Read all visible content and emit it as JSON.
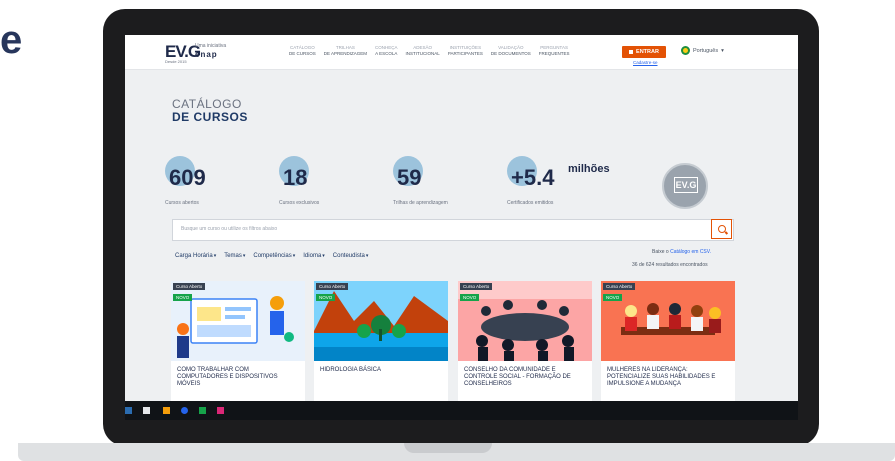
{
  "side_text": "e",
  "header": {
    "logo": "EV.G",
    "logo_tag": "Uma iniciativa",
    "logo_org": "enap",
    "logo_since": "Desde 2015",
    "nav": [
      {
        "l1": "CATÁLOGO",
        "l2": "DE CURSOS"
      },
      {
        "l1": "TRILHAS",
        "l2": "DE APRENDIZAGEM"
      },
      {
        "l1": "CONHEÇA",
        "l2": "A ESCOLA"
      },
      {
        "l1": "ADESÃO",
        "l2": "INSTITUCIONAL"
      },
      {
        "l1": "INSTITUIÇÕES",
        "l2": "PARTICIPANTES"
      },
      {
        "l1": "VALIDAÇÃO",
        "l2": "DE DOCUMENTOS"
      },
      {
        "l1": "PERGUNTAS",
        "l2": "FREQUENTES"
      }
    ],
    "entrar_label": "ENTRAR",
    "cadastre_label": "Cadastre-se",
    "language_label": "Português"
  },
  "page": {
    "title_line1": "CATÁLOGO",
    "title_line2": "DE CURSOS"
  },
  "stats": [
    {
      "value": "609",
      "label": "Cursos abertos"
    },
    {
      "value": "18",
      "label": "Cursos exclusivos"
    },
    {
      "value": "59",
      "label": "Trilhas de aprendizagem"
    },
    {
      "value": "+5.4",
      "label": "Certificados emitidos"
    }
  ],
  "stats_unit": "milhões",
  "badge_text": "EV.G",
  "search": {
    "placeholder": "Busque um curso ou utilize os filtros abaixo"
  },
  "filters": [
    "Carga Horária",
    "Temas",
    "Competências",
    "Idioma",
    "Conteudista"
  ],
  "csv_prefix": "Baixe o",
  "csv_link": "Catálogo em CSV.",
  "results_text": "36 de 624 resultados encontrados",
  "cards": [
    {
      "tag": "Curso Aberto",
      "new": "NOVO",
      "title": "COMO TRABALHAR COM COMPUTADORES E DISPOSITIVOS MÓVEIS"
    },
    {
      "tag": "Curso Aberto",
      "new": "NOVO",
      "title": "HIDROLOGIA BÁSICA"
    },
    {
      "tag": "Curso Aberto",
      "new": "NOVO",
      "title": "CONSELHO DA COMUNIDADE E CONTROLE SOCIAL - FORMAÇÃO DE CONSELHEIROS"
    },
    {
      "tag": "Curso Aberto",
      "new": "NOVO",
      "title": "MULHERES NA LIDERANÇA: POTENCIALIZE SUAS HABILIDADES E IMPULSIONE A MUDANÇA"
    }
  ],
  "colors": {
    "accent": "#e35205",
    "navy": "#1f3a66",
    "stat_circle": "#9cc3dc"
  }
}
